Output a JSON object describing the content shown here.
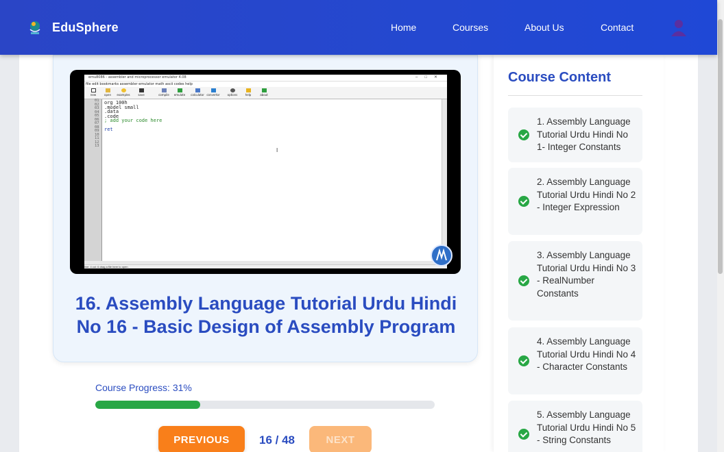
{
  "header": {
    "brand": "EduSphere",
    "nav": [
      "Home",
      "Courses",
      "About Us",
      "Contact"
    ]
  },
  "video": {
    "app_title": "emu8086 - assembler and microprocessor emulator 4.08",
    "menu": "file  edit  bookmarks  assembler  emulator  math  ascii codes  help",
    "tools": [
      "new",
      "open",
      "examples",
      "save",
      "compile",
      "emulate",
      "calculator",
      "convertor",
      "options",
      "help",
      "about"
    ],
    "line_numbers": [
      "01",
      "02",
      "03",
      "04",
      "05",
      "06",
      "07",
      "08",
      "09",
      "10",
      "11",
      "12",
      "13"
    ],
    "code_lines": [
      "org 100h",
      ".model small",
      ".data",
      ".code",
      "; add your code here",
      "",
      "ret"
    ],
    "status": "line: 4        col: 6                                                   drag a file here to open"
  },
  "lesson": {
    "title": "16. Assembly Language Tutorial Urdu Hindi No 16 - Basic Design of Assembly Program"
  },
  "progress": {
    "label": "Course Progress: 31%",
    "fraction": 0.31
  },
  "pager": {
    "previous": "PREVIOUS",
    "next": "NEXT",
    "position": "16 / 48"
  },
  "sidebar": {
    "title": "Course Content",
    "items": [
      {
        "label": "1. Assembly Language Tutorial Urdu Hindi No 1- Integer Constants",
        "done": true
      },
      {
        "label": "2. Assembly Language Tutorial Urdu Hindi No 2 - Integer Expression",
        "done": true
      },
      {
        "label": "3. Assembly Language Tutorial Urdu Hindi No 3 - RealNumber Constants",
        "done": true
      },
      {
        "label": "4. Assembly Language Tutorial Urdu Hindi No 4 - Character Constants",
        "done": true
      },
      {
        "label": "5. Assembly Language Tutorial Urdu Hindi No 5 - String Constants",
        "done": true
      }
    ]
  },
  "colors": {
    "header": "#2448d0",
    "accent": "#2a4cc0",
    "progress": "#28a745",
    "button_primary": "#f97f1a",
    "button_disabled": "#fbb87a"
  }
}
